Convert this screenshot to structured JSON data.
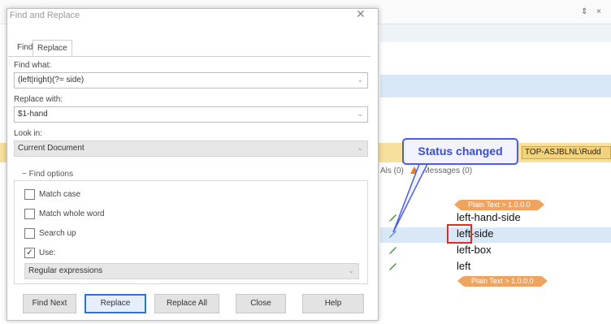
{
  "background": {
    "window_controls": "⇕ ×",
    "context_text": "TOP-ASJBLNL\\Rudd",
    "tabs_row": {
      "left": "Als (0)",
      "right": "Messages (0)"
    },
    "tag_pill": "Plain Text > 1.0.0.0",
    "segments": [
      "left-hand-side",
      "left-side",
      "left-box",
      "left"
    ],
    "highlighted_segment_index": 1,
    "callout": "Status changed"
  },
  "dialog": {
    "title": "Find and Replace",
    "tabs": [
      "Find",
      "Replace"
    ],
    "active_tab": "Replace",
    "find_what": {
      "label": "Find what:",
      "value": "(left|right)(?= side)"
    },
    "replace_with": {
      "label": "Replace with:",
      "value": "$1-hand"
    },
    "look_in": {
      "label": "Look in:",
      "value": "Current Document"
    },
    "find_options": {
      "title": "Find options",
      "match_case": {
        "label": "Match case",
        "checked": false
      },
      "match_whole_word": {
        "label": "Match whole word",
        "checked": false
      },
      "search_up": {
        "label": "Search up",
        "checked": false
      },
      "use": {
        "label": "Use:",
        "checked": true
      },
      "use_mode": "Regular expressions"
    },
    "buttons": {
      "find_next": "Find Next",
      "replace": "Replace",
      "replace_all": "Replace All",
      "close": "Close",
      "help": "Help"
    }
  },
  "colors": {
    "accent": "#2b73d9",
    "callout": "#4a5de3",
    "pill": "#f0a35e",
    "highlight": "#d9e8f6",
    "yellow_bar": "#f7df9e",
    "red_box": "#d93025"
  }
}
